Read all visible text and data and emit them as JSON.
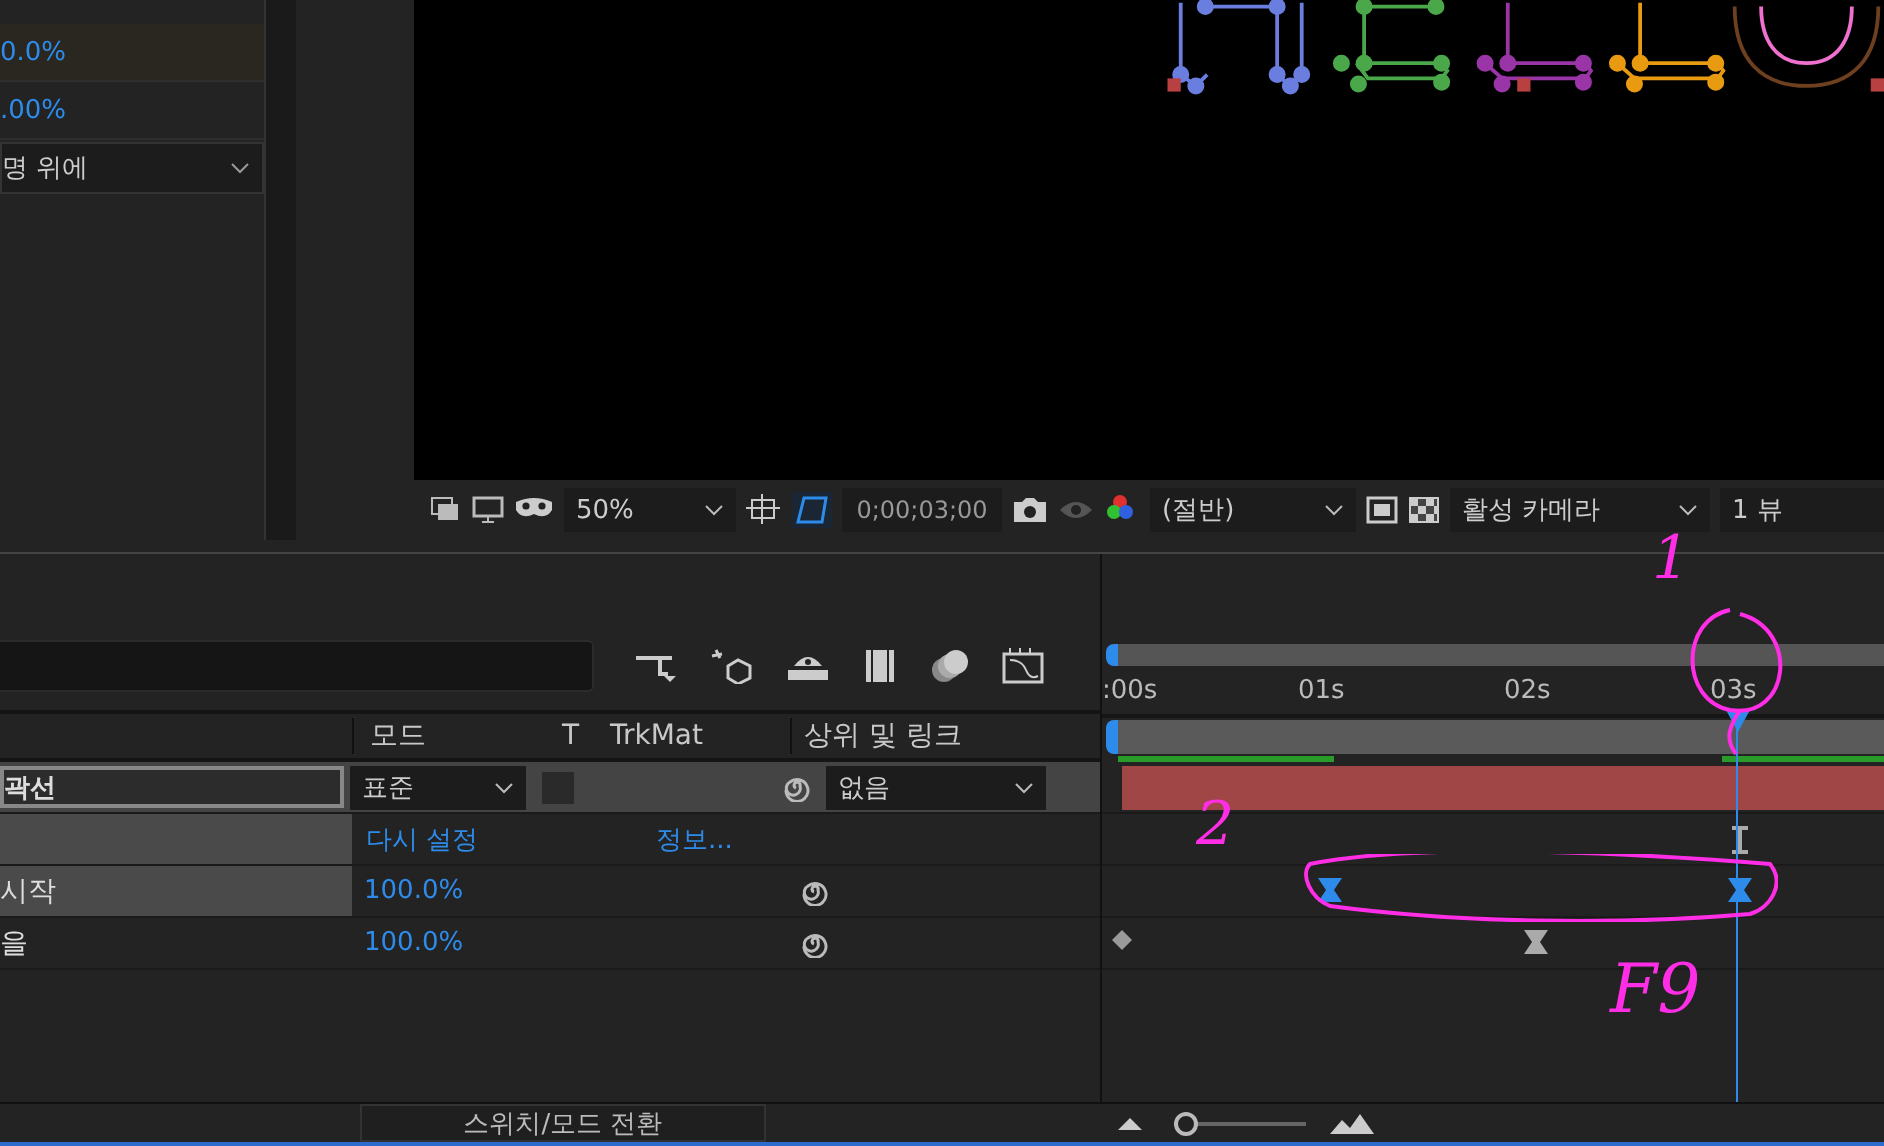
{
  "effect_controls": {
    "values": [
      "0.0%",
      ".00%"
    ],
    "dropdown": "명 위에"
  },
  "viewer": {
    "toolbar": {
      "zoom": "50%",
      "timecode": "0;00;03;00",
      "resolution": "(절반)",
      "camera": "활성 카메라",
      "views": "1 뷰"
    }
  },
  "timeline": {
    "columns": {
      "mode": "모드",
      "t": "T",
      "trkmat": "TrkMat",
      "parent": "상위 및 링크"
    },
    "layer": {
      "name": "곽선",
      "mode": "표준",
      "parent": "없음",
      "selected": true
    },
    "property_links": [
      "다시 설정",
      "정보..."
    ],
    "properties": [
      {
        "name": "시작",
        "value": "100.0%",
        "selected": true
      },
      {
        "name": "을",
        "value": "100.0%",
        "selected": false
      }
    ],
    "ruler": [
      ":00s",
      "01s",
      "02s",
      "03s"
    ],
    "playhead": {
      "level": 0.809
    },
    "keyframe_rows": [
      {
        "keyframes": [
          {
            "kind": "ibeam",
            "level": 0.809,
            "selected": false
          }
        ]
      },
      {
        "keyframes": [
          {
            "kind": "hourglass",
            "level": 0.272,
            "selected": true
          },
          {
            "kind": "hourglass",
            "level": 0.809,
            "selected": true
          }
        ]
      },
      {
        "keyframes": [
          {
            "kind": "diamond",
            "level": 0.0,
            "selected": false
          },
          {
            "kind": "hourglass",
            "level": 0.542,
            "selected": false
          }
        ]
      }
    ],
    "switch_button": "스위치/모드 전환",
    "zoom_slider": {
      "level": 0.0
    }
  },
  "annotations": [
    {
      "text": "1"
    },
    {
      "text": "2"
    },
    {
      "text": "F9"
    }
  ]
}
